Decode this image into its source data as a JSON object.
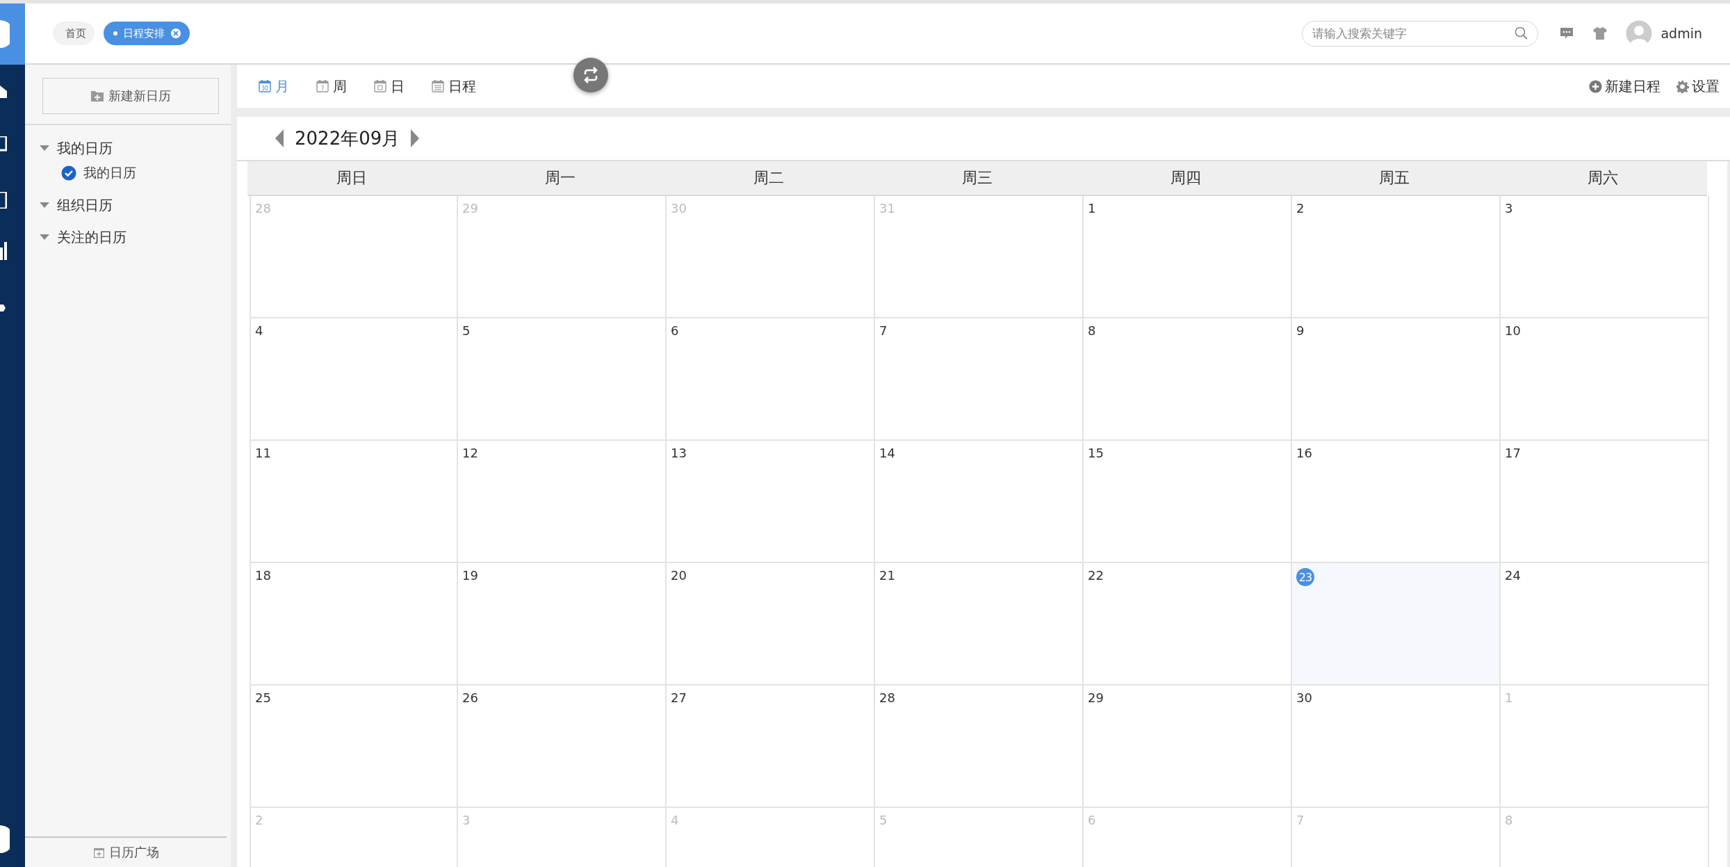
{
  "header": {
    "tabs": [
      {
        "label": "首页",
        "selected": false,
        "closable": false
      },
      {
        "label": "日程安排",
        "selected": true,
        "closable": true
      }
    ],
    "search": {
      "placeholder": "请输入搜索关键字"
    },
    "user": {
      "name": "admin"
    }
  },
  "sidebar": {
    "new_calendar_button": "新建新日历",
    "groups": [
      {
        "label": "我的日历",
        "children": [
          {
            "label": "我的日历",
            "checked": true
          }
        ]
      },
      {
        "label": "组织日历"
      },
      {
        "label": "关注的日历"
      }
    ],
    "footer_link": "日历广场"
  },
  "toolbar": {
    "views": [
      {
        "kind": "month",
        "label": "月",
        "icon_text": "30",
        "selected": true
      },
      {
        "kind": "week",
        "label": "周",
        "icon_text": "7",
        "selected": false
      },
      {
        "kind": "day",
        "label": "日",
        "selected": false
      },
      {
        "kind": "agenda",
        "label": "日程",
        "selected": false
      }
    ],
    "actions": [
      {
        "kind": "add",
        "label": "新建日程"
      },
      {
        "kind": "settings",
        "label": "设置"
      }
    ]
  },
  "calendar": {
    "month_label": "2022年09月",
    "weekdays": [
      "周日",
      "周一",
      "周二",
      "周三",
      "周四",
      "周五",
      "周六"
    ],
    "weeks": [
      [
        {
          "day": "28",
          "in_month": false,
          "today": false
        },
        {
          "day": "29",
          "in_month": false,
          "today": false
        },
        {
          "day": "30",
          "in_month": false,
          "today": false
        },
        {
          "day": "31",
          "in_month": false,
          "today": false
        },
        {
          "day": "1",
          "in_month": true,
          "today": false
        },
        {
          "day": "2",
          "in_month": true,
          "today": false
        },
        {
          "day": "3",
          "in_month": true,
          "today": false
        }
      ],
      [
        {
          "day": "4",
          "in_month": true,
          "today": false
        },
        {
          "day": "5",
          "in_month": true,
          "today": false
        },
        {
          "day": "6",
          "in_month": true,
          "today": false
        },
        {
          "day": "7",
          "in_month": true,
          "today": false
        },
        {
          "day": "8",
          "in_month": true,
          "today": false
        },
        {
          "day": "9",
          "in_month": true,
          "today": false
        },
        {
          "day": "10",
          "in_month": true,
          "today": false
        }
      ],
      [
        {
          "day": "11",
          "in_month": true,
          "today": false
        },
        {
          "day": "12",
          "in_month": true,
          "today": false
        },
        {
          "day": "13",
          "in_month": true,
          "today": false
        },
        {
          "day": "14",
          "in_month": true,
          "today": false
        },
        {
          "day": "15",
          "in_month": true,
          "today": false
        },
        {
          "day": "16",
          "in_month": true,
          "today": false
        },
        {
          "day": "17",
          "in_month": true,
          "today": false
        }
      ],
      [
        {
          "day": "18",
          "in_month": true,
          "today": false
        },
        {
          "day": "19",
          "in_month": true,
          "today": false
        },
        {
          "day": "20",
          "in_month": true,
          "today": false
        },
        {
          "day": "21",
          "in_month": true,
          "today": false
        },
        {
          "day": "22",
          "in_month": true,
          "today": false
        },
        {
          "day": "23",
          "in_month": true,
          "today": true
        },
        {
          "day": "24",
          "in_month": true,
          "today": false
        }
      ],
      [
        {
          "day": "25",
          "in_month": true,
          "today": false
        },
        {
          "day": "26",
          "in_month": true,
          "today": false
        },
        {
          "day": "27",
          "in_month": true,
          "today": false
        },
        {
          "day": "28",
          "in_month": true,
          "today": false
        },
        {
          "day": "29",
          "in_month": true,
          "today": false
        },
        {
          "day": "30",
          "in_month": true,
          "today": false
        },
        {
          "day": "1",
          "in_month": false,
          "today": false
        }
      ],
      [
        {
          "day": "2",
          "in_month": false,
          "today": false
        },
        {
          "day": "3",
          "in_month": false,
          "today": false
        },
        {
          "day": "4",
          "in_month": false,
          "today": false
        },
        {
          "day": "5",
          "in_month": false,
          "today": false
        },
        {
          "day": "6",
          "in_month": false,
          "today": false
        },
        {
          "day": "7",
          "in_month": false,
          "today": false
        },
        {
          "day": "8",
          "in_month": false,
          "today": false
        }
      ]
    ]
  }
}
